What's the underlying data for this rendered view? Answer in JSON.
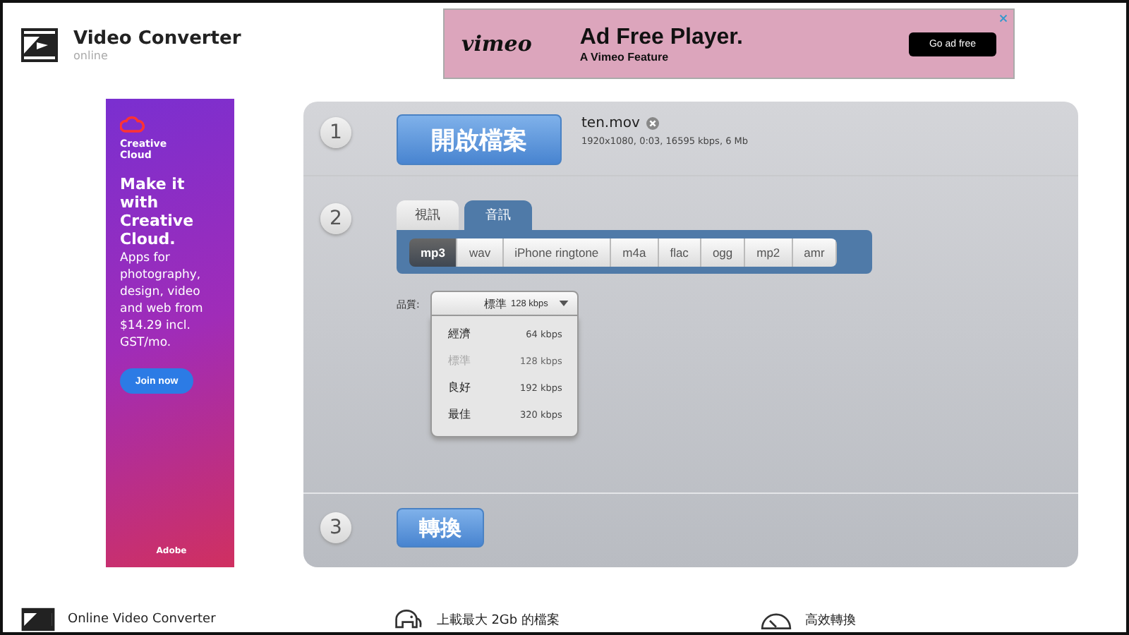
{
  "header": {
    "title": "Video Converter",
    "subtitle": "online"
  },
  "top_ad": {
    "brand": "vimeo",
    "headline": "Ad Free Player.",
    "tagline": "A Vimeo Feature",
    "button": "Go ad free"
  },
  "side_ad": {
    "brand": "Creative Cloud",
    "headline": "Make it with Creative Cloud.",
    "body": "Apps for photography, design, video and web from $14.29 incl. GST/mo.",
    "button": "Join now",
    "footer": "Adobe"
  },
  "steps": [
    {
      "number": "1"
    },
    {
      "number": "2"
    },
    {
      "number": "3"
    }
  ],
  "open_button": "開啟檔案",
  "file": {
    "name": "ten.mov",
    "info": "1920x1080, 0:03, 16595 kbps, 6 Mb"
  },
  "tabs": [
    {
      "label": "視訊",
      "selected": false
    },
    {
      "label": "音訊",
      "selected": true
    }
  ],
  "formats": [
    {
      "label": "mp3",
      "selected": true
    },
    {
      "label": "wav",
      "selected": false
    },
    {
      "label": "iPhone ringtone",
      "selected": false
    },
    {
      "label": "m4a",
      "selected": false
    },
    {
      "label": "flac",
      "selected": false
    },
    {
      "label": "ogg",
      "selected": false
    },
    {
      "label": "mp2",
      "selected": false
    },
    {
      "label": "amr",
      "selected": false
    }
  ],
  "quality": {
    "label": "品質:",
    "value": "標準",
    "value_rate": "128 kbps",
    "options": [
      {
        "name": "經濟",
        "rate": "64 kbps",
        "selected": false
      },
      {
        "name": "標準",
        "rate": "128 kbps",
        "selected": true
      },
      {
        "name": "良好",
        "rate": "192 kbps",
        "selected": false
      },
      {
        "name": "最佳",
        "rate": "320 kbps",
        "selected": false
      }
    ]
  },
  "convert_button": "轉換",
  "features": [
    {
      "kind": "film",
      "title": "Online Video Converter"
    },
    {
      "kind": "elephant",
      "title": "上載最大 2Gb 的檔案"
    },
    {
      "kind": "gauge",
      "title": "高效轉換"
    }
  ]
}
